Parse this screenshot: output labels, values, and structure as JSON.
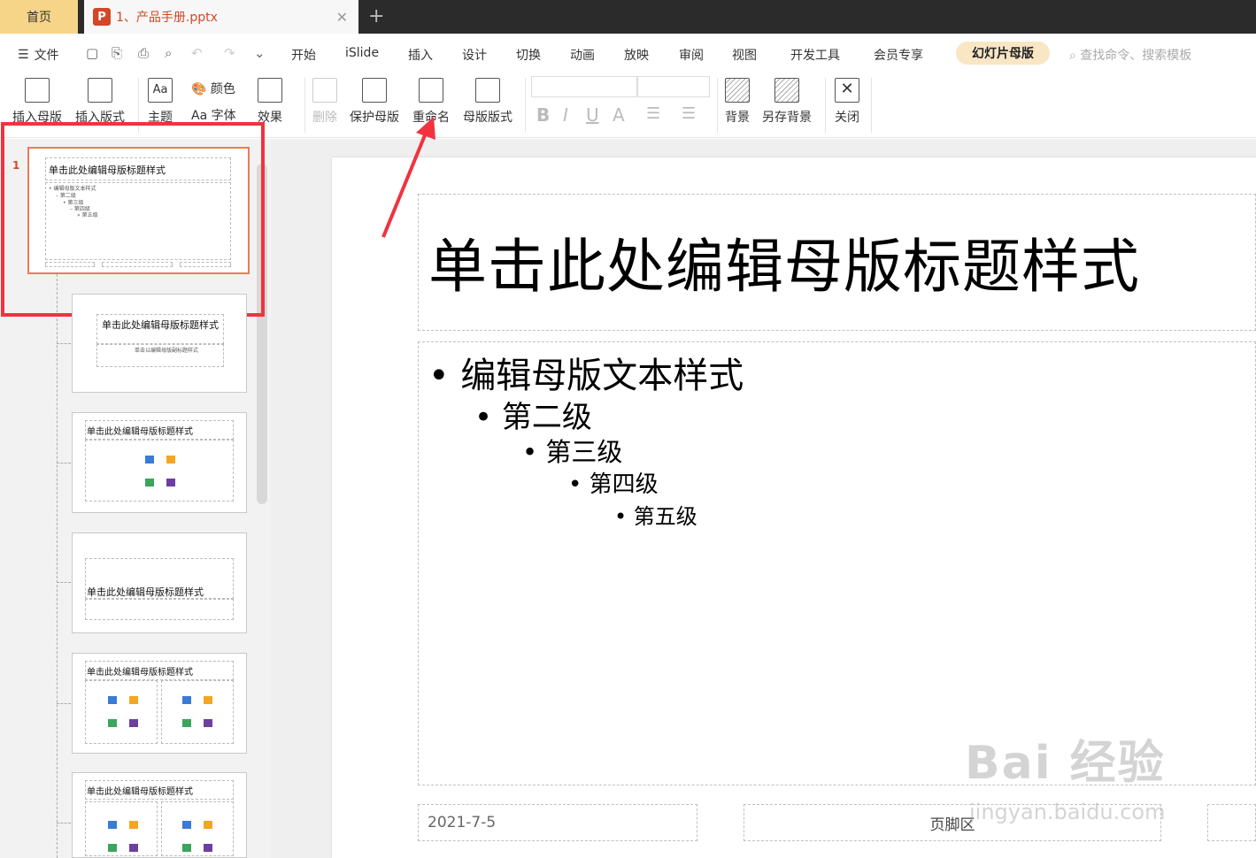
{
  "tabs": {
    "home": "首页",
    "file": "1、产品手册.pptx",
    "file_icon": "P"
  },
  "menubar": {
    "file": "文件",
    "items": [
      "开始",
      "iSlide",
      "插入",
      "设计",
      "切换",
      "动画",
      "放映",
      "审阅",
      "视图",
      "开发工具",
      "会员专享"
    ],
    "active": "幻灯片母版",
    "search_placeholder": "查找命令、搜索模板"
  },
  "ribbon": {
    "insert_master": "插入母版",
    "insert_layout": "插入版式",
    "theme": "主题",
    "color": "颜色",
    "font": "字体",
    "effect": "效果",
    "delete": "删除",
    "protect_master": "保护母版",
    "rename": "重命名",
    "master_layout": "母版版式",
    "background": "背景",
    "save_background": "另存背景",
    "close": "关闭",
    "font_glyph": "Aa",
    "bold": "B",
    "italic": "I",
    "underline": "U",
    "fontcolor": "A"
  },
  "thumbnails": {
    "slide_number": "1",
    "master_title": "单击此处编辑母版标题样式",
    "master_body": [
      "• 编辑母版文本样式",
      "– 第二级",
      "• 第三级",
      "– 第四级",
      "» 第五级"
    ],
    "layout2_title": "单击此处编辑母版标题样式",
    "layout2_sub": "单击以编辑母版副标题样式",
    "layout3_title": "单击此处编辑母版标题样式",
    "layout4_title": "单击此处编辑母版标题样式",
    "layout5_title": "单击此处编辑母版标题样式",
    "layout6_title": "单击此处编辑母版标题样式"
  },
  "slide": {
    "title": "单击此处编辑母版标题样式",
    "levels": [
      "编辑母版文本样式",
      "第二级",
      "第三级",
      "第四级",
      "第五级"
    ],
    "date": "2021-7-5",
    "footer": "页脚区"
  },
  "watermark": {
    "brand": "Bai 经验",
    "url": "jingyan.baidu.com"
  },
  "colors": {
    "accent_red": "#f0333f",
    "thumb_border": "#f07a55",
    "ppt_orange": "#d24726",
    "active_tab": "#f6d488"
  }
}
